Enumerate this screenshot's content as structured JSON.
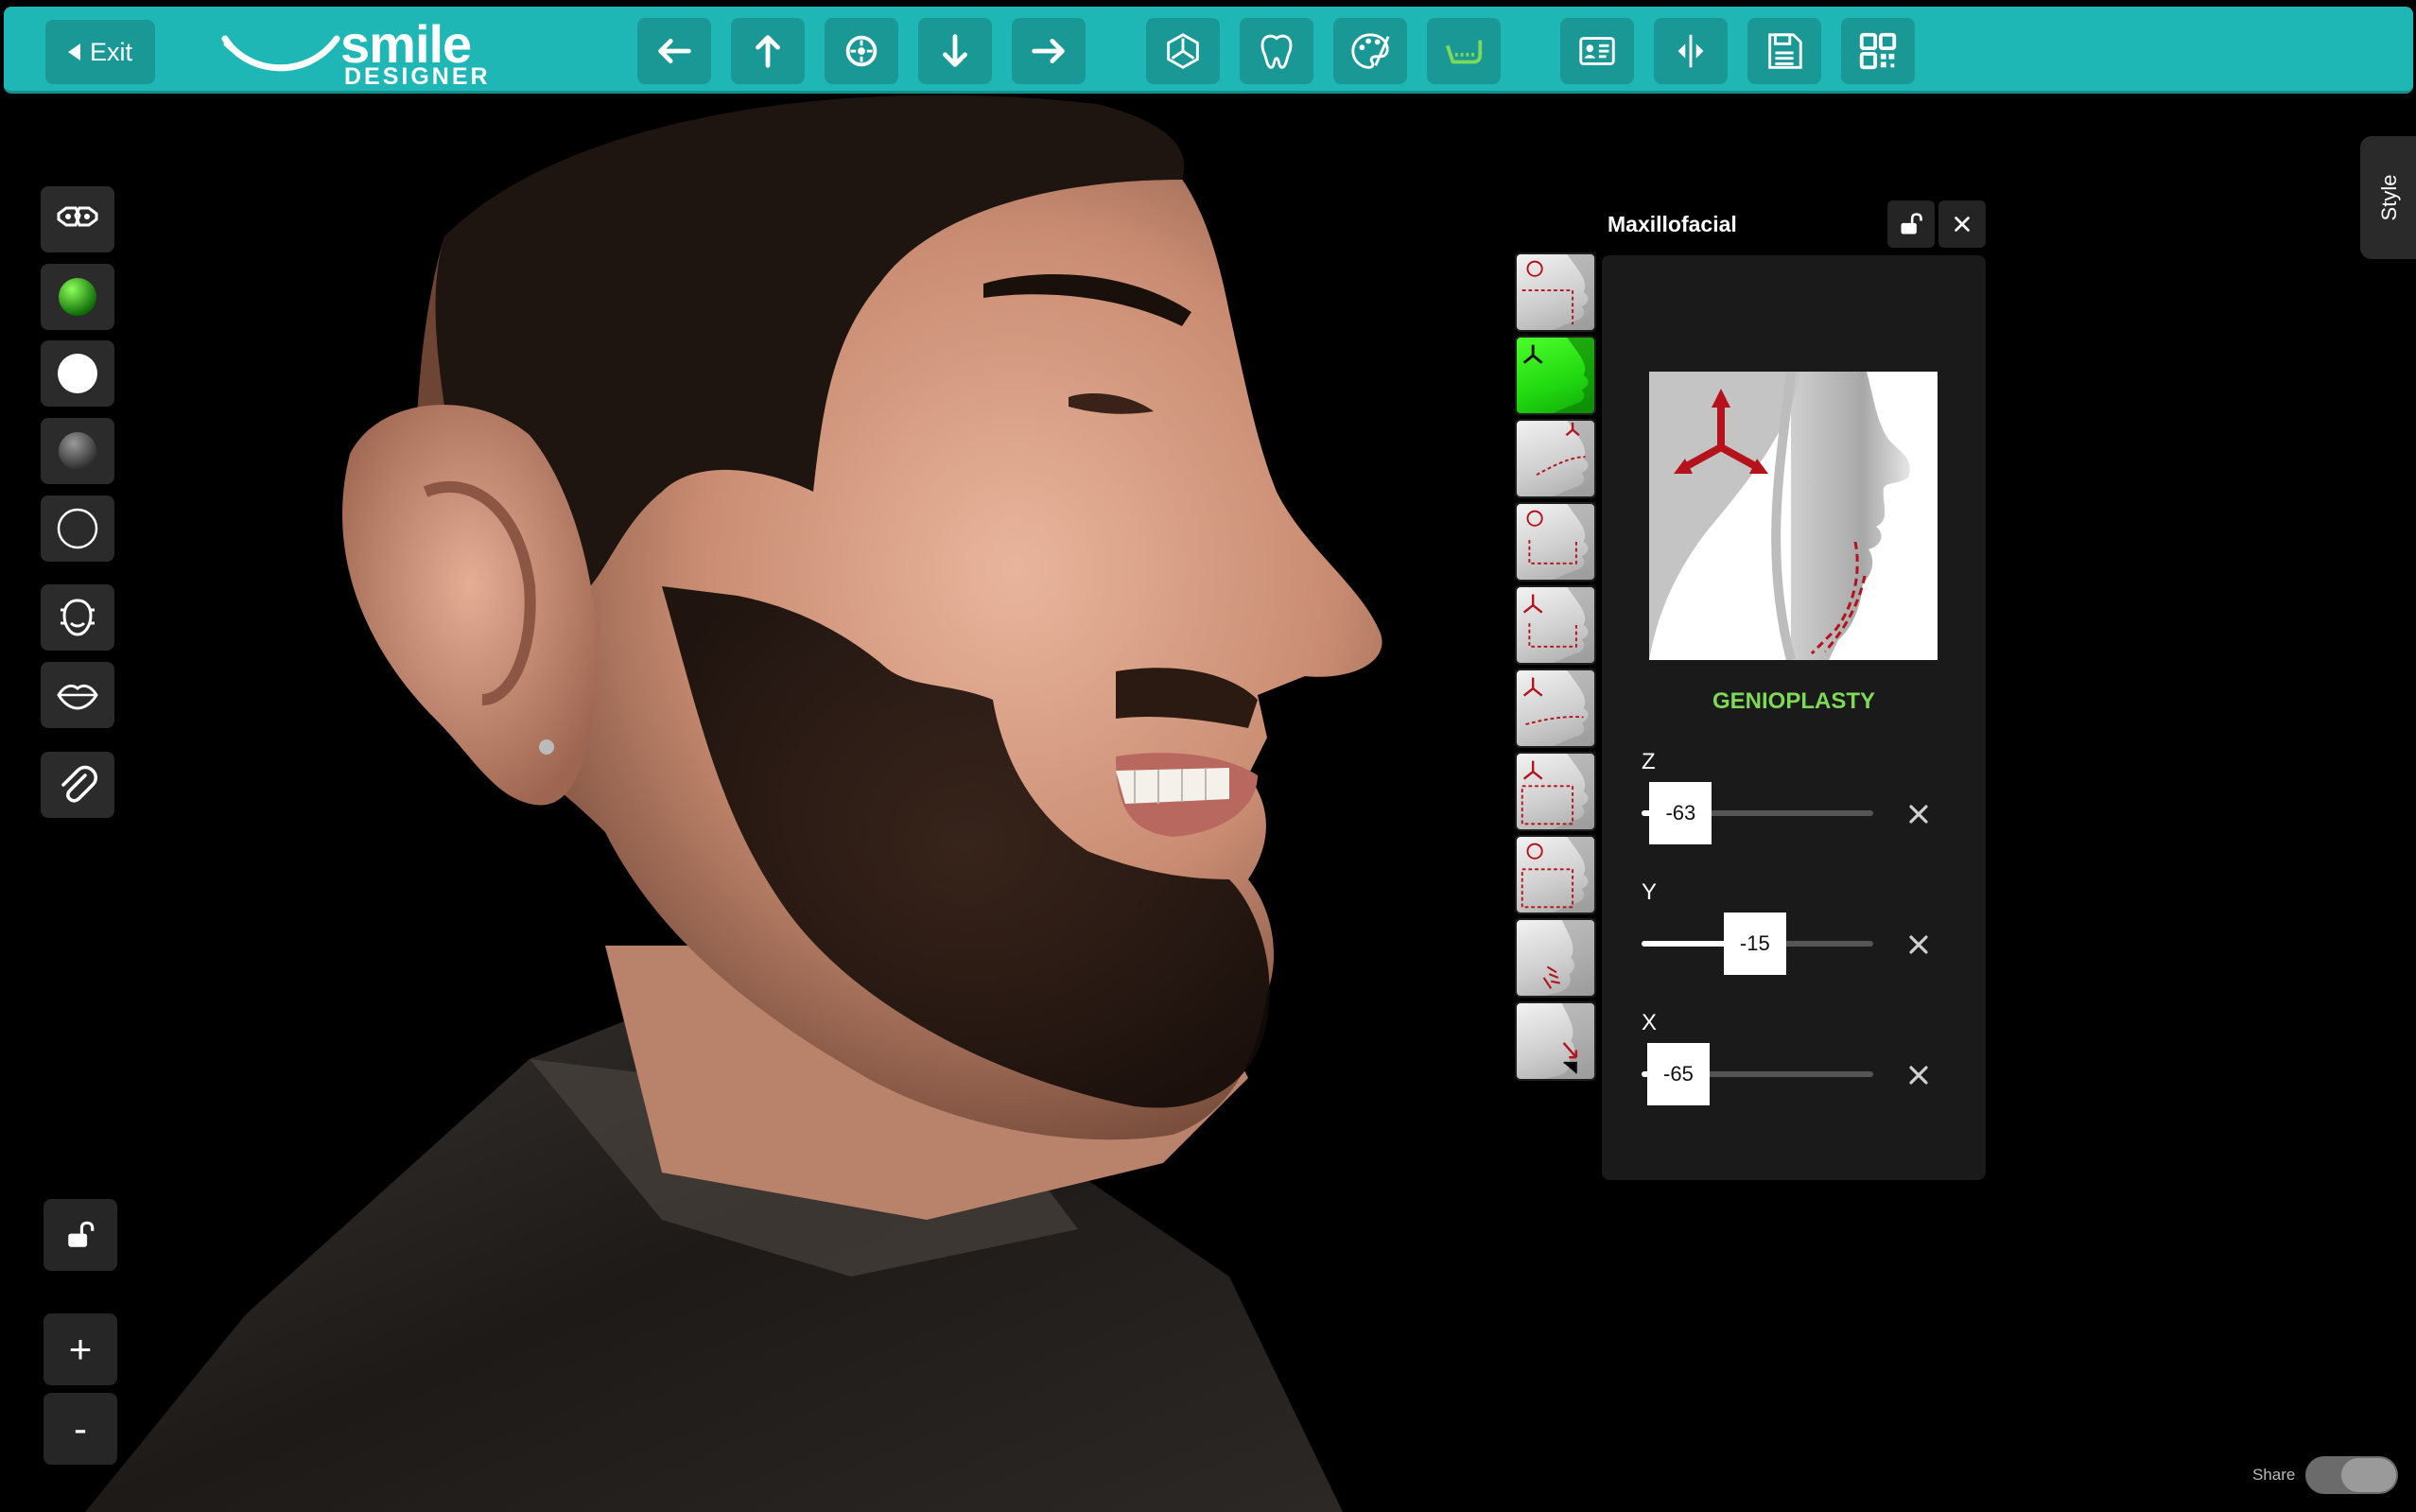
{
  "toolbar": {
    "exit_label": "Exit",
    "logo_word1": "smile",
    "logo_word2": "DESIGNER",
    "nav_icons": [
      "arrow-left-icon",
      "arrow-up-icon",
      "center-target-icon",
      "arrow-down-icon",
      "arrow-right-icon"
    ],
    "mode_icons": [
      "3d-axes-icon",
      "tooth-icon",
      "palette-icon",
      "jaw-icon"
    ],
    "action_icons": [
      "patient-card-icon",
      "split-view-icon",
      "save-icon",
      "qr-code-icon"
    ],
    "active_mode_color": "#7ed957"
  },
  "left_tools": [
    "masks-icon",
    "green-sphere-icon",
    "white-sphere-icon",
    "grey-sphere-icon",
    "outline-circle-icon",
    "face-scan-icon",
    "lips-icon",
    "paperclip-icon"
  ],
  "panel": {
    "title": "Maxillofacial",
    "procedure": "GENIOPLASTY",
    "thumbnails_count": 10,
    "active_thumbnail": 1,
    "sliders": [
      {
        "axis": "Z",
        "value": "-63",
        "fraction": 0.12
      },
      {
        "axis": "Y",
        "value": "-15",
        "fraction": 0.44
      },
      {
        "axis": "X",
        "value": "-65",
        "fraction": 0.11
      }
    ]
  },
  "style_tab": "Style",
  "zoom": {
    "in_label": "+",
    "out_label": "-"
  },
  "share_label": "Share",
  "colors": {
    "toolbar": "#1fb7b5",
    "accent_green": "#7ed957",
    "marker_red": "#b5121b"
  }
}
